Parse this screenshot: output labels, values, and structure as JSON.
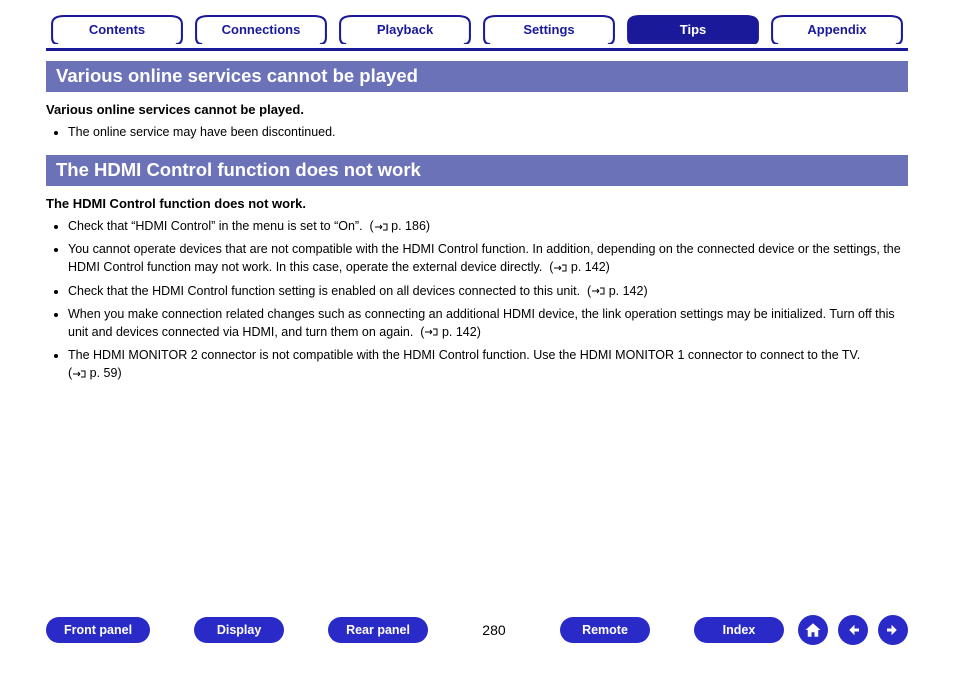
{
  "tabs": [
    {
      "label": "Contents",
      "active": false
    },
    {
      "label": "Connections",
      "active": false
    },
    {
      "label": "Playback",
      "active": false
    },
    {
      "label": "Settings",
      "active": false
    },
    {
      "label": "Tips",
      "active": true
    },
    {
      "label": "Appendix",
      "active": false
    }
  ],
  "section1": {
    "title": "Various online services cannot be played",
    "subtitle": "Various online services cannot be played.",
    "items": [
      "The online service may have been discontinued."
    ]
  },
  "section2": {
    "title": "The HDMI Control function does not work",
    "subtitle": "The HDMI Control function does not work.",
    "items": [
      {
        "text": "Check that “HDMI Control” in the menu is set to “On”.",
        "ref": "p. 186"
      },
      {
        "text": "You cannot operate devices that are not compatible with the HDMI Control function. In addition, depending on the connected device or the settings, the HDMI Control function may not work. In this case, operate the external device directly.",
        "ref": "p. 142"
      },
      {
        "text": "Check that the HDMI Control function setting is enabled on all devices connected to this unit.",
        "ref": "p. 142"
      },
      {
        "text": "When you make connection related changes such as connecting an additional HDMI device, the link operation settings may be initialized. Turn off this unit and devices connected via HDMI, and turn them on again.",
        "ref": "p. 142"
      },
      {
        "text": "The HDMI MONITOR 2 connector is not compatible with the HDMI Control function. Use the HDMI MONITOR 1 connector to connect to the TV.",
        "ref": "p. 59"
      }
    ]
  },
  "footer": {
    "buttons": [
      "Front panel",
      "Display",
      "Rear panel",
      "Remote",
      "Index"
    ],
    "page": "280"
  }
}
